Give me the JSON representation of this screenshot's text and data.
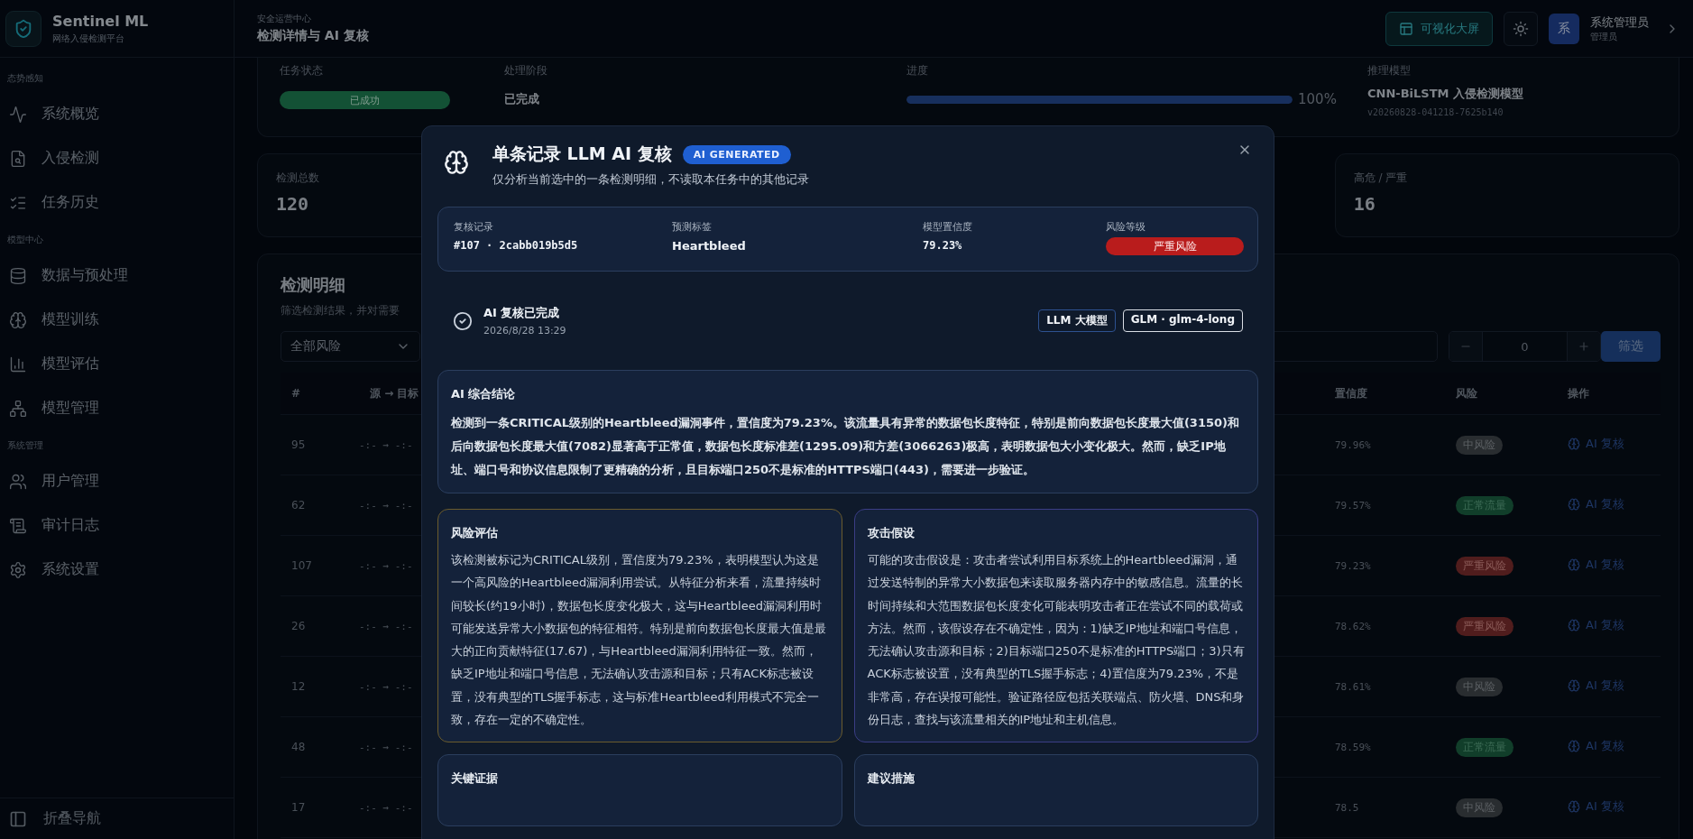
{
  "brand": {
    "name": "Sentinel ML",
    "subtitle": "网络入侵检测平台"
  },
  "header": {
    "eyebrow": "安全运营中心",
    "title": "检测详情与 AI 复核",
    "screen_button": "可视化大屏",
    "user": {
      "avatar": "系",
      "name": "系统管理员",
      "role": "管理员"
    }
  },
  "sidebar": {
    "sections": [
      {
        "title": "态势感知",
        "items": [
          {
            "label": "系统概览"
          },
          {
            "label": "入侵检测"
          },
          {
            "label": "任务历史"
          }
        ]
      },
      {
        "title": "模型中心",
        "items": [
          {
            "label": "数据与预处理"
          },
          {
            "label": "模型训练"
          },
          {
            "label": "模型评估"
          },
          {
            "label": "模型管理"
          }
        ]
      },
      {
        "title": "系统管理",
        "items": [
          {
            "label": "用户管理"
          },
          {
            "label": "审计日志"
          },
          {
            "label": "系统设置"
          }
        ]
      }
    ],
    "collapse": "折叠导航"
  },
  "task": {
    "status_label": "任务状态",
    "status": "已成功",
    "stage_label": "处理阶段",
    "stage": "已完成",
    "progress_label": "进度",
    "progress": {
      "level": 1,
      "reading": "100%"
    },
    "model_label": "推理模型",
    "model": "CNN-BiLSTM 入侵检测模型",
    "model_version": "v20260828-041218-7625b140"
  },
  "stats": [
    {
      "label": "检测总数",
      "value": "120"
    },
    {
      "label": "高危 / 严重",
      "value": "16"
    }
  ],
  "details": {
    "title": "检测明细",
    "subtitle": "筛选检测结果，并对需要",
    "risk_filter": "全部风险",
    "stepper_value": "0",
    "filter_button": "筛选",
    "columns": [
      "#",
      "源 → 目标",
      "置信度",
      "风险",
      "操作"
    ],
    "rows": [
      {
        "index": "95",
        "flow": "-:- → -:-",
        "confidence": "79.96%",
        "risk": {
          "label": "中风险",
          "kind": "medium"
        },
        "action": "AI 复核"
      },
      {
        "index": "62",
        "flow": "-:- → -:-",
        "confidence": "79.57%",
        "risk": {
          "label": "正常流量",
          "kind": "normal"
        },
        "action": "AI 复核"
      },
      {
        "index": "107",
        "flow": "-:- → -:-",
        "confidence": "79.23%",
        "risk": {
          "label": "严重风险",
          "kind": "critical"
        },
        "action": "AI 复核"
      },
      {
        "index": "26",
        "flow": "-:- → -:-",
        "confidence": "78.62%",
        "risk": {
          "label": "严重风险",
          "kind": "critical"
        },
        "action": "AI 复核"
      },
      {
        "index": "12",
        "flow": "-:- → -:-",
        "confidence": "78.61%",
        "risk": {
          "label": "中风险",
          "kind": "medium"
        },
        "action": "AI 复核"
      },
      {
        "index": "48",
        "flow": "-:- → -:-",
        "confidence": "78.59%",
        "risk": {
          "label": "正常流量",
          "kind": "normal"
        },
        "action": "AI 复核"
      },
      {
        "index": "17",
        "flow": "-:- → -:-",
        "confidence": "78.5",
        "risk": {
          "label": "中风险",
          "kind": "medium"
        },
        "action": "AI 复核"
      }
    ]
  },
  "modal": {
    "title": "单条记录 LLM AI 复核",
    "badge": "AI GENERATED",
    "subtitle": "仅分析当前选中的一条检测明细，不读取本任务中的其他记录",
    "summary": [
      {
        "label": "复核记录",
        "value": "#107 · 2cabb019b5d5",
        "kind": "mono"
      },
      {
        "label": "预测标签",
        "value": "Heartbleed",
        "kind": "text"
      },
      {
        "label": "模型置信度",
        "value": "79.23%",
        "kind": "mono"
      },
      {
        "label": "风险等级",
        "value": "严重风险",
        "kind": "critical"
      }
    ],
    "status": {
      "title": "AI 复核已完成",
      "time": "2026/8/28 13:29",
      "tags": [
        {
          "label": "LLM 大模型",
          "kind": "provider"
        },
        {
          "label": "GLM · glm-4-long",
          "kind": "model"
        }
      ]
    },
    "conclusion": {
      "title": "AI 综合结论",
      "text": "检测到一条CRITICAL级别的Heartbleed漏洞事件，置信度为79.23%。该流量具有异常的数据包长度特征，特别是前向数据包长度最大值(3150)和后向数据包长度最大值(7082)显著高于正常值，数据包长度标准差(1295.09)和方差(3066263)极高，表明数据包大小变化极大。然而，缺乏IP地址、端口号和协议信息限制了更精确的分析，且目标端口250不是标准的HTTPS端口(443)，需要进一步验证。"
    },
    "sections": [
      {
        "title": "风险评估",
        "kind": "risk",
        "text": "该检测被标记为CRITICAL级别，置信度为79.23%，表明模型认为这是一个高风险的Heartbleed漏洞利用尝试。从特征分析来看，流量持续时间较长(约19小时)，数据包长度变化极大，这与Heartbleed漏洞利用时可能发送异常大小数据包的特征相符。特别是前向数据包长度最大值是最大的正向贡献特征(17.67)，与Heartbleed漏洞利用特征一致。然而，缺乏IP地址和端口号信息，无法确认攻击源和目标；只有ACK标志被设置，没有典型的TLS握手标志，这与标准Heartbleed利用模式不完全一致，存在一定的不确定性。"
      },
      {
        "title": "攻击假设",
        "kind": "hypothesis",
        "text": "可能的攻击假设是：攻击者尝试利用目标系统上的Heartbleed漏洞，通过发送特制的异常大小数据包来读取服务器内存中的敏感信息。流量的长时间持续和大范围数据包长度变化可能表明攻击者正在尝试不同的载荷或方法。然而，该假设存在不确定性，因为：1)缺乏IP地址和端口号信息，无法确认攻击源和目标；2)目标端口250不是标准的HTTPS端口；3)只有ACK标志被设置，没有典型的TLS握手标志；4)置信度为79.23%，不是非常高，存在误报可能性。验证路径应包括关联端点、防火墙、DNS和身份日志，查找与该流量相关的IP地址和主机信息。"
      },
      {
        "title": "关键证据",
        "kind": "plain"
      },
      {
        "title": "建议措施",
        "kind": "plain"
      }
    ]
  }
}
